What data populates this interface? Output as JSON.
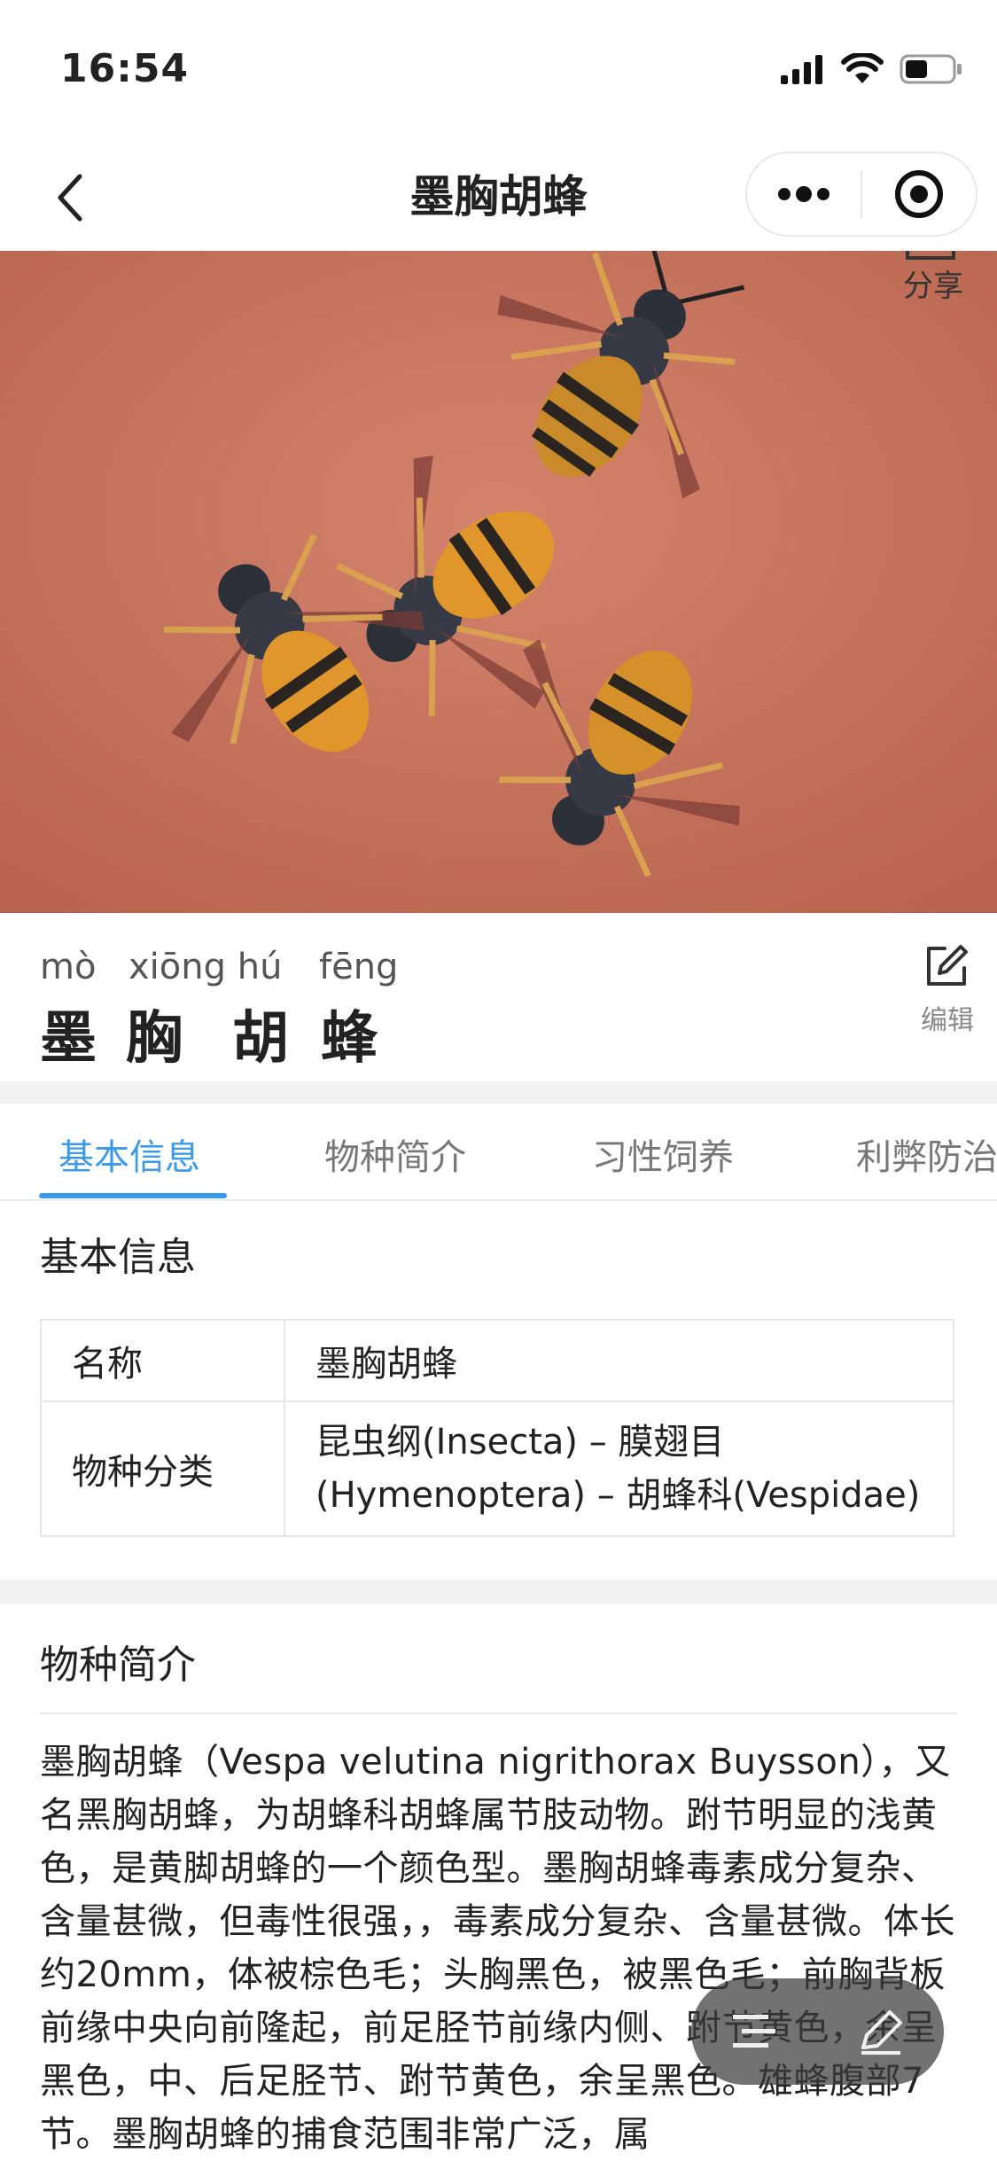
{
  "status_bar": {
    "time": "16:54"
  },
  "nav": {
    "title": "墨胸胡蜂"
  },
  "hero": {
    "share_label": "分享"
  },
  "name": {
    "pinyin": [
      "mò",
      "xiōng hú",
      "fēng"
    ],
    "chars": [
      "墨",
      "胸",
      "胡",
      "蜂"
    ],
    "edit_label": "编辑"
  },
  "tabs": [
    {
      "label": "基本信息",
      "active": true
    },
    {
      "label": "物种简介",
      "active": false
    },
    {
      "label": "习性饲养",
      "active": false
    },
    {
      "label": "利弊防治",
      "active": false
    }
  ],
  "basic_info": {
    "title": "基本信息",
    "rows": [
      {
        "label": "名称",
        "value": "墨胸胡蜂"
      },
      {
        "label": "物种分类",
        "value_line1": "昆虫纲(Insecta) – 膜翅目",
        "value_line2": "(Hymenoptera) – 胡蜂科(Vespidae)"
      }
    ]
  },
  "intro": {
    "title": "物种简介",
    "text": "墨胸胡蜂（Vespa velutina nigrithorax Buysson），又名黑胸胡蜂，为胡蜂科胡蜂属节肢动物。跗节明显的浅黄色，是黄脚胡蜂的一个颜色型。墨胸胡蜂毒素成分复杂、含量甚微，但毒性很强，，毒素成分复杂、含量甚微。体长约20mm，体被棕色毛；头胸黑色，被黑色毛；前胸背板前缘中央向前隆起，前足胫节前缘内侧、跗节黄色，余呈黑色，中、后足胫节、跗节黄色，余呈黑色。雄蜂腹部7节。墨胸胡蜂的捕食范围非常广泛，属"
  },
  "colors": {
    "accent": "#3d9ae8",
    "hero_bg": "#c8735e"
  },
  "icons": [
    "signal-icon",
    "wifi-icon",
    "battery-icon",
    "back-arrow-icon",
    "more-icon",
    "close-target-icon",
    "share-icon",
    "edit-icon",
    "list-icon",
    "pen-icon"
  ]
}
